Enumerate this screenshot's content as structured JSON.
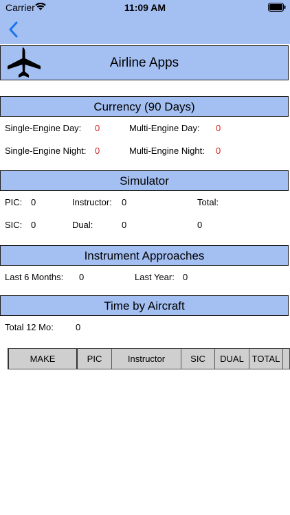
{
  "status_bar": {
    "carrier": "Carrier",
    "time": "11:09 AM"
  },
  "nav": {
    "back_icon": "chevron-left-icon"
  },
  "header": {
    "title": "Airline Apps",
    "icon": "airplane-icon"
  },
  "currency": {
    "title": "Currency (90 Days)",
    "single_engine_day_label": "Single-Engine Day:",
    "single_engine_day_value": "0",
    "multi_engine_day_label": "Multi-Engine Day:",
    "multi_engine_day_value": "0",
    "single_engine_night_label": "Single-Engine Night:",
    "single_engine_night_value": "0",
    "multi_engine_night_label": "Multi-Engine Night:",
    "multi_engine_night_value": "0"
  },
  "simulator": {
    "title": "Simulator",
    "pic_label": "PIC:",
    "pic_value": "0",
    "instructor_label": "Instructor:",
    "instructor_value": "0",
    "total_label": "Total:",
    "sic_label": "SIC:",
    "sic_value": "0",
    "dual_label": "Dual:",
    "dual_value": "0",
    "total_value": "0"
  },
  "approaches": {
    "title": "Instrument Approaches",
    "last6_label": "Last 6 Months:",
    "last6_value": "0",
    "last_year_label": "Last Year:",
    "last_year_value": "0"
  },
  "aircraft": {
    "title": "Time by Aircraft",
    "total12_label": "Total 12 Mo:",
    "total12_value": "0",
    "columns": [
      "MAKE",
      "PIC",
      "Instructor",
      "SIC",
      "DUAL",
      "TOTAL"
    ]
  },
  "colors": {
    "header_bg": "#a4bff1",
    "accent_blue": "#1a73e8",
    "value_red": "#d31f1f",
    "table_header_bg": "#cfcfcf"
  }
}
